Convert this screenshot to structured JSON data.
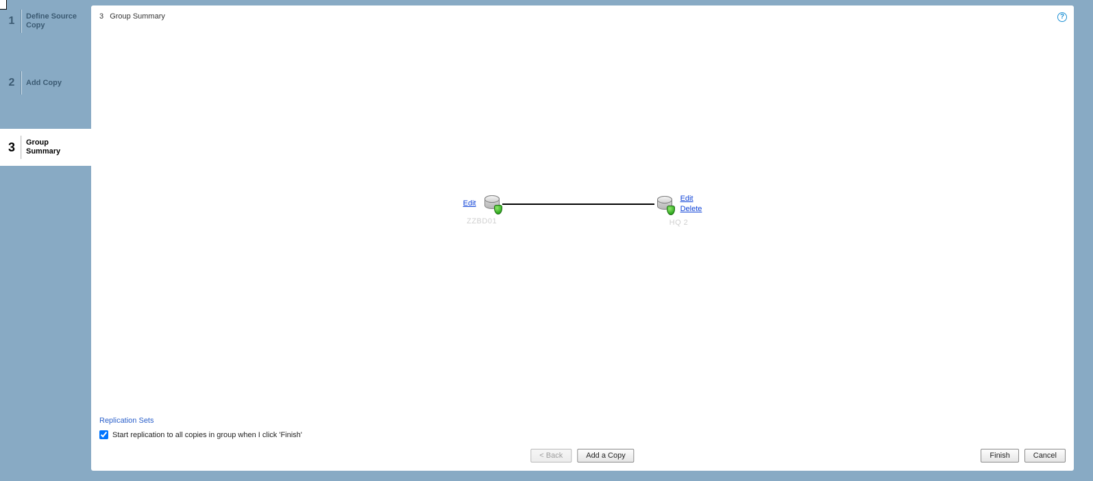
{
  "wizard": {
    "steps": [
      {
        "num": "1",
        "label": "Define Source Copy"
      },
      {
        "num": "2",
        "label": "Add Copy"
      },
      {
        "num": "3",
        "label": "Group Summary"
      }
    ],
    "active_index": 2
  },
  "header": {
    "num": "3",
    "title": "Group Summary"
  },
  "help_tooltip": "?",
  "diagram": {
    "source": {
      "edit_label": "Edit",
      "caption": "ZZBD01"
    },
    "target": {
      "edit_label": "Edit",
      "delete_label": "Delete",
      "caption": "HQ 2"
    }
  },
  "bottom": {
    "replication_sets_label": "Replication Sets",
    "start_replication_label": "Start replication to all copies in group when I click 'Finish'",
    "start_replication_checked": true
  },
  "buttons": {
    "back": "< Back",
    "add_copy": "Add a Copy",
    "finish": "Finish",
    "cancel": "Cancel"
  }
}
